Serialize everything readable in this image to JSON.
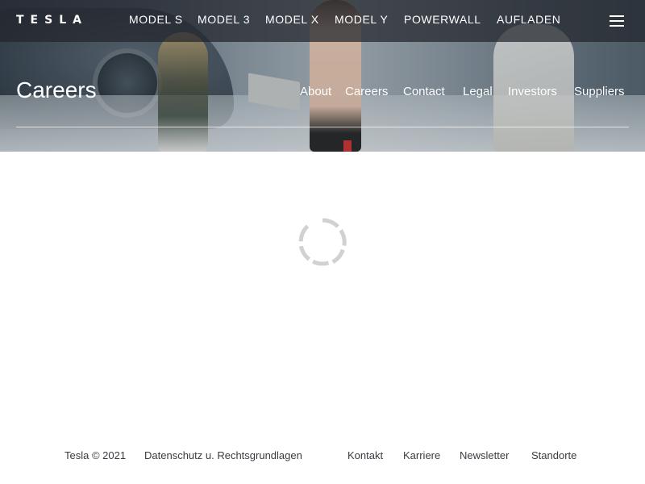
{
  "brand": {
    "logo_text": "TESLA"
  },
  "topnav": {
    "items": [
      {
        "label": "MODEL S"
      },
      {
        "label": "MODEL 3"
      },
      {
        "label": "MODEL X"
      },
      {
        "label": "MODEL Y"
      },
      {
        "label": "POWERWALL"
      },
      {
        "label": "AUFLADEN"
      }
    ],
    "menu_icon": "hamburger-menu-icon"
  },
  "hero": {
    "title": "Careers",
    "subnav": [
      {
        "label": "About"
      },
      {
        "label": "Careers"
      },
      {
        "label": "Contact"
      },
      {
        "label": "Legal"
      },
      {
        "label": "Investors"
      },
      {
        "label": "Suppliers"
      }
    ]
  },
  "main": {
    "loading_icon": "loading-spinner-icon"
  },
  "footer": {
    "copyright": "Tesla © 2021",
    "links": [
      {
        "label": "Datenschutz u. Rechtsgrundlagen"
      },
      {
        "label": "Kontakt"
      },
      {
        "label": "Karriere"
      },
      {
        "label": "Newsletter"
      },
      {
        "label": "Standorte"
      }
    ]
  },
  "colors": {
    "nav_bg": "#22262c",
    "text_dark": "#393c41",
    "spinner": "#d0d1d2"
  }
}
